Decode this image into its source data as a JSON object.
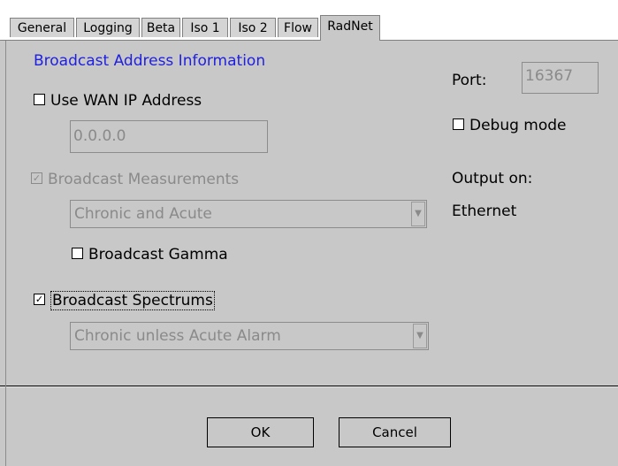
{
  "tabs": [
    {
      "label": "General"
    },
    {
      "label": "Logging"
    },
    {
      "label": "Beta"
    },
    {
      "label": "Iso 1"
    },
    {
      "label": "Iso 2"
    },
    {
      "label": "Flow"
    },
    {
      "label": "RadNet"
    }
  ],
  "active_tab": "RadNet",
  "section_title": "Broadcast Address Information",
  "use_wan": {
    "label": "Use WAN IP Address",
    "checked": false,
    "mark": ""
  },
  "wan_ip": {
    "value": "0.0.0.0"
  },
  "broadcast_measurements": {
    "label": "Broadcast Measurements",
    "checked": true,
    "mark": "✓"
  },
  "measurements_combo": {
    "value": "Chronic and Acute",
    "arrow": "▼"
  },
  "broadcast_gamma": {
    "label": "Broadcast Gamma",
    "checked": false,
    "mark": ""
  },
  "broadcast_spectrums": {
    "label": "Broadcast Spectrums",
    "checked": true,
    "mark": "✓"
  },
  "spectrums_combo": {
    "value": "Chronic unless Acute Alarm",
    "arrow": "▼"
  },
  "port": {
    "label": "Port:",
    "value": "16367"
  },
  "debug_mode": {
    "label": "Debug mode",
    "checked": false,
    "mark": ""
  },
  "output": {
    "label": "Output on:",
    "value": "Ethernet"
  },
  "buttons": {
    "ok": "OK",
    "cancel": "Cancel"
  }
}
